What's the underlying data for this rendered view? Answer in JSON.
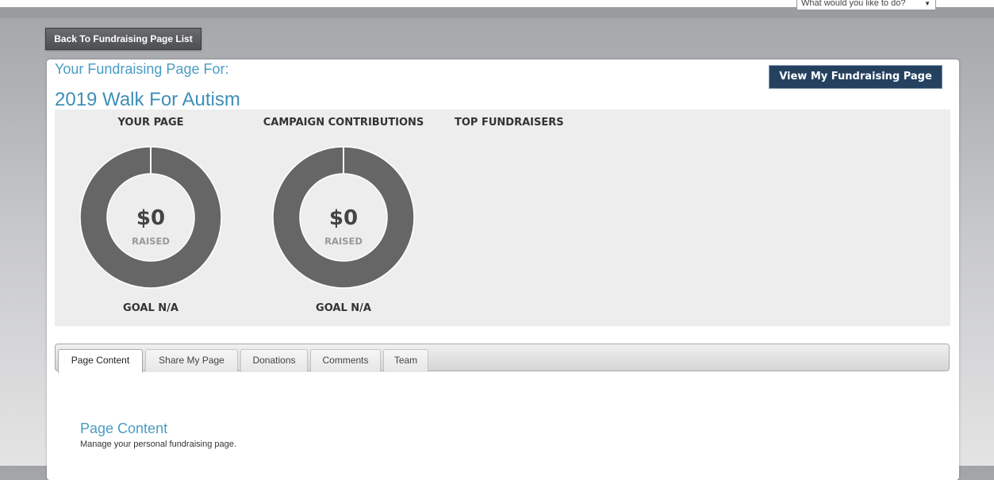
{
  "header": {
    "action_select": {
      "value": "What would you like to do?"
    },
    "back_button": "Back To Fundraising Page List"
  },
  "panel": {
    "page_for_label": "Your Fundraising Page For:",
    "campaign_title": "2019 Walk For Autism",
    "view_button": "View My Fundraising Page"
  },
  "stats": {
    "your_page": {
      "heading": "YOUR PAGE",
      "amount": "$0",
      "raised_label": "RAISED",
      "goal": "GOAL N/A",
      "progress_percent": 0
    },
    "campaign": {
      "heading": "CAMPAIGN CONTRIBUTIONS",
      "amount": "$0",
      "raised_label": "RAISED",
      "goal": "GOAL N/A",
      "progress_percent": 0
    },
    "top_fundraisers": {
      "heading": "TOP FUNDRAISERS"
    }
  },
  "tabs": [
    {
      "label": "Page Content",
      "active": true
    },
    {
      "label": "Share My Page",
      "active": false
    },
    {
      "label": "Donations",
      "active": false
    },
    {
      "label": "Comments",
      "active": false
    },
    {
      "label": "Team",
      "active": false
    }
  ],
  "content": {
    "section_title": "Page Content",
    "section_subtitle": "Manage your personal fundraising page."
  },
  "colors": {
    "link_blue": "#4a9cc4",
    "view_button_bg": "#24415f",
    "ring_fill": "#666666",
    "stats_bg": "#ededed"
  },
  "icons": {
    "select_caret": "caret-down-icon"
  }
}
